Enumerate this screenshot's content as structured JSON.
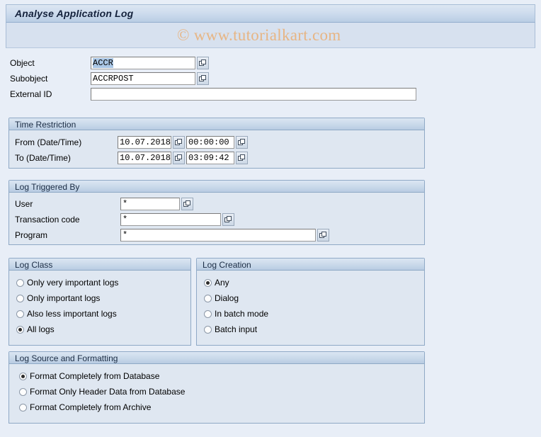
{
  "window": {
    "title": "Analyse Application Log",
    "watermark": "© www.tutorialkart.com"
  },
  "header_fields": [
    {
      "label": "Object",
      "value": "ACCR",
      "selected": true,
      "matchcode": true,
      "icon": "matchcode-icon"
    },
    {
      "label": "Subobject",
      "value": "ACCRPOST",
      "selected": false,
      "matchcode": true,
      "icon": "matchcode-icon"
    },
    {
      "label": "External ID",
      "value": "",
      "selected": false,
      "matchcode": false,
      "icon": ""
    }
  ],
  "time_restriction": {
    "title": "Time Restriction",
    "rows": [
      {
        "label": "From (Date/Time)",
        "date": "10.07.2018",
        "time": "00:00:00"
      },
      {
        "label": "To (Date/Time)",
        "date": "10.07.2018",
        "time": "03:09:42"
      }
    ]
  },
  "log_triggered_by": {
    "title": "Log Triggered By",
    "rows": [
      {
        "label": "User",
        "value": "*"
      },
      {
        "label": "Transaction code",
        "value": "*"
      },
      {
        "label": "Program",
        "value": "*"
      }
    ]
  },
  "log_class": {
    "title": "Log Class",
    "options": [
      {
        "label": "Only very important logs",
        "selected": false
      },
      {
        "label": "Only important logs",
        "selected": false
      },
      {
        "label": "Also less important logs",
        "selected": false
      },
      {
        "label": "All logs",
        "selected": true
      }
    ]
  },
  "log_creation": {
    "title": "Log Creation",
    "options": [
      {
        "label": "Any",
        "selected": true
      },
      {
        "label": "Dialog",
        "selected": false
      },
      {
        "label": "In batch mode",
        "selected": false
      },
      {
        "label": "Batch input",
        "selected": false
      }
    ]
  },
  "log_source": {
    "title": "Log Source and Formatting",
    "options": [
      {
        "label": "Format Completely from Database",
        "selected": true
      },
      {
        "label": "Format Only Header Data from Database",
        "selected": false
      },
      {
        "label": "Format Completely from Archive",
        "selected": false
      }
    ]
  },
  "colors": {
    "page_background": "#e8eef7",
    "panel_background": "#dfe7f1",
    "panel_border": "#8fa9c6",
    "title_text": "#14223c",
    "watermark": "#e7b584",
    "selection_highlight": "#aac7e6"
  }
}
